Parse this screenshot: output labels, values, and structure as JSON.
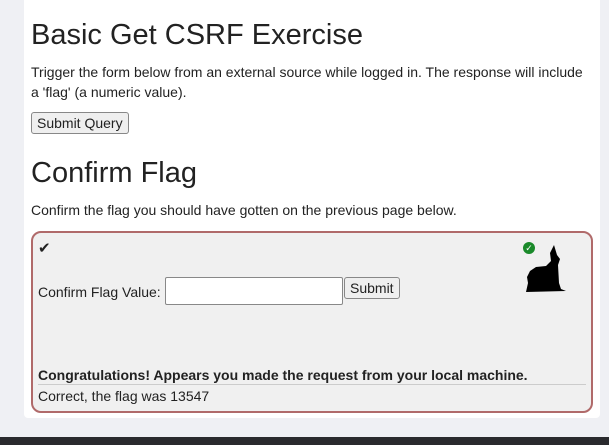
{
  "exercise": {
    "title": "Basic Get CSRF Exercise",
    "description": "Trigger the form below from an external source while logged in. The response will include a 'flag' (a numeric value).",
    "submit_query_label": "Submit Query"
  },
  "confirm": {
    "title": "Confirm Flag",
    "description": "Confirm the flag you should have gotten on the previous page below.",
    "check_icon": "✔",
    "field_label": "Confirm Flag Value:",
    "field_value": "",
    "submit_label": "Submit",
    "success_icon": "✓",
    "congrats": "Congratulations! Appears you made the request from your local machine.",
    "result": "Correct, the flag was 13547"
  },
  "colors": {
    "box_border": "#b06a6a",
    "success": "#1a8a2a"
  }
}
